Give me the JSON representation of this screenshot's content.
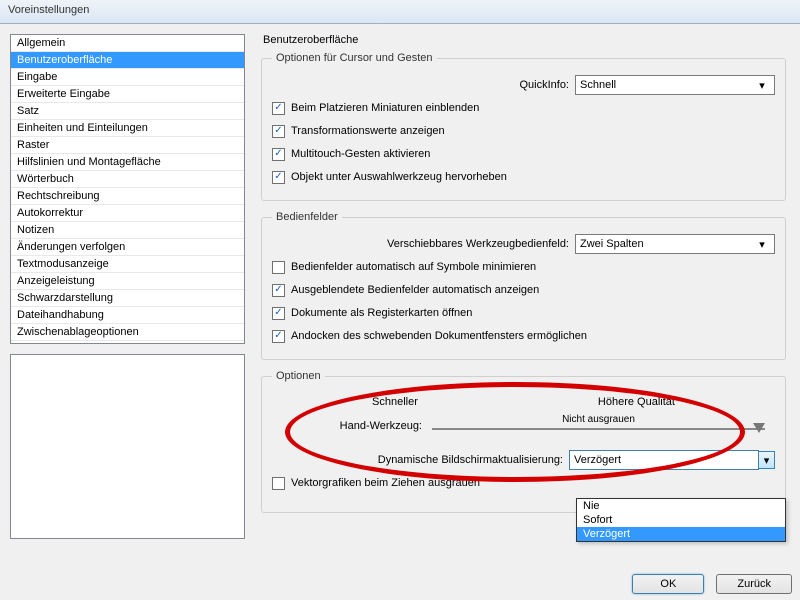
{
  "title": "Voreinstellungen",
  "sidebar": {
    "items": [
      "Allgemein",
      "Benutzeroberfläche",
      "Eingabe",
      "Erweiterte Eingabe",
      "Satz",
      "Einheiten und Einteilungen",
      "Raster",
      "Hilfslinien und Montagefläche",
      "Wörterbuch",
      "Rechtschreibung",
      "Autokorrektur",
      "Notizen",
      "Änderungen verfolgen",
      "Textmodusanzeige",
      "Anzeigeleistung",
      "Schwarzdarstellung",
      "Dateihandhabung",
      "Zwischenablageoptionen"
    ],
    "selected_index": 1
  },
  "content": {
    "heading": "Benutzeroberfläche",
    "cursor": {
      "legend": "Optionen für Cursor und Gesten",
      "quickinfo_label": "QuickInfo:",
      "quickinfo_value": "Schnell",
      "check1": "Beim Platzieren Miniaturen einblenden",
      "check2": "Transformationswerte anzeigen",
      "check3": "Multitouch-Gesten aktivieren",
      "check4": "Objekt unter Auswahlwerkzeug hervorheben"
    },
    "panels": {
      "legend": "Bedienfelder",
      "tool_label": "Verschiebbares Werkzeugbedienfeld:",
      "tool_value": "Zwei Spalten",
      "check1": "Bedienfelder automatisch auf Symbole minimieren",
      "check2": "Ausgeblendete Bedienfelder automatisch anzeigen",
      "check3": "Dokumente als Registerkarten öffnen",
      "check4": "Andocken des schwebenden Dokumentfensters ermöglichen"
    },
    "options": {
      "legend": "Optionen",
      "faster": "Schneller",
      "quality": "Höhere Qualität",
      "no_gray": "Nicht ausgrauen",
      "hand_label": "Hand-Werkzeug:",
      "redraw_label": "Dynamische Bildschirmaktualisierung:",
      "redraw_value": "Verzögert",
      "redraw_options": [
        "Nie",
        "Sofort",
        "Verzögert"
      ],
      "redraw_selected_index": 2,
      "vector_label": "Vektorgrafiken beim Ziehen ausgrauen"
    }
  },
  "buttons": {
    "ok": "OK",
    "back": "Zurück"
  }
}
